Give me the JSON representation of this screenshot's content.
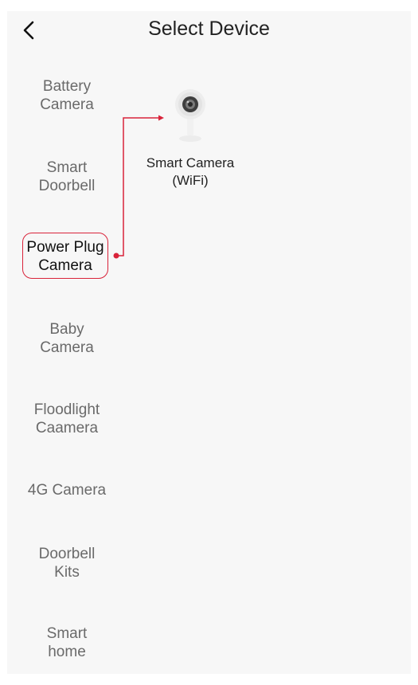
{
  "header": {
    "title": "Select Device",
    "back_icon": "chevron-left-icon"
  },
  "categories": [
    {
      "line1": "Battery",
      "line2": "Camera",
      "selected": false
    },
    {
      "line1": "Smart",
      "line2": "Doorbell",
      "selected": false
    },
    {
      "line1": "Power Plug",
      "line2": "Camera",
      "selected": true
    },
    {
      "line1": "Baby",
      "line2": "Camera",
      "selected": false
    },
    {
      "line1": "Floodlight",
      "line2": "Caamera",
      "selected": false
    },
    {
      "line1": "4G Camera",
      "line2": "",
      "selected": false
    },
    {
      "line1": "Doorbell",
      "line2": "Kits",
      "selected": false
    },
    {
      "line1": "Smart",
      "line2": "home",
      "selected": false
    }
  ],
  "product": {
    "name": "Smart Camera",
    "subtitle": "(WiFi)",
    "icon": "indoor-camera-icon"
  },
  "colors": {
    "accent": "#d9233a",
    "background": "#f7f7f7"
  }
}
